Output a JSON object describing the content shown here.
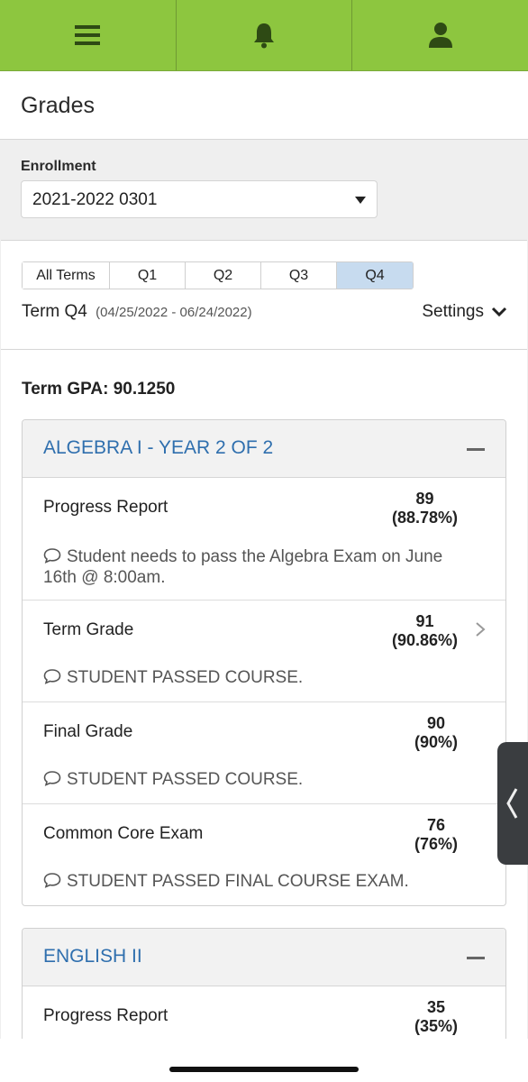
{
  "page": {
    "title": "Grades"
  },
  "enrollment": {
    "label": "Enrollment",
    "selected": "2021-2022 0301"
  },
  "terms": {
    "tabs": [
      "All Terms",
      "Q1",
      "Q2",
      "Q3",
      "Q4"
    ],
    "active": "Q4"
  },
  "term_info": {
    "name": "Term Q4",
    "dates": "(04/25/2022 - 06/24/2022)",
    "settings_label": "Settings"
  },
  "gpa": {
    "text": "Term GPA: 90.1250"
  },
  "courses": [
    {
      "name": "ALGEBRA I - YEAR 2 OF 2",
      "rows": [
        {
          "label": "Progress Report",
          "grade": "89",
          "percent": "(88.78%)",
          "comment": "Student needs to pass the Algebra Exam on June 16th @ 8:00am."
        },
        {
          "label": "Term Grade",
          "grade": "91",
          "percent": "(90.86%)",
          "comment": "STUDENT PASSED COURSE."
        },
        {
          "label": "Final Grade",
          "grade": "90",
          "percent": "(90%)",
          "comment": "STUDENT PASSED COURSE."
        },
        {
          "label": "Common Core Exam",
          "grade": "76",
          "percent": "(76%)",
          "comment": "STUDENT PASSED FINAL COURSE EXAM."
        }
      ]
    },
    {
      "name": "ENGLISH II",
      "rows": [
        {
          "label": "Progress Report",
          "grade": "35",
          "percent": "(35%)"
        }
      ]
    }
  ],
  "colors": {
    "topbar": "#8dc63f",
    "link_blue": "#2f6fae",
    "active_tab": "#c7dbef"
  },
  "icons": {
    "menu": "hamburger-icon",
    "notifications": "bell-icon",
    "profile": "user-icon",
    "comment": "speech-bubble-icon",
    "side_handle": "chevron-left-icon"
  }
}
